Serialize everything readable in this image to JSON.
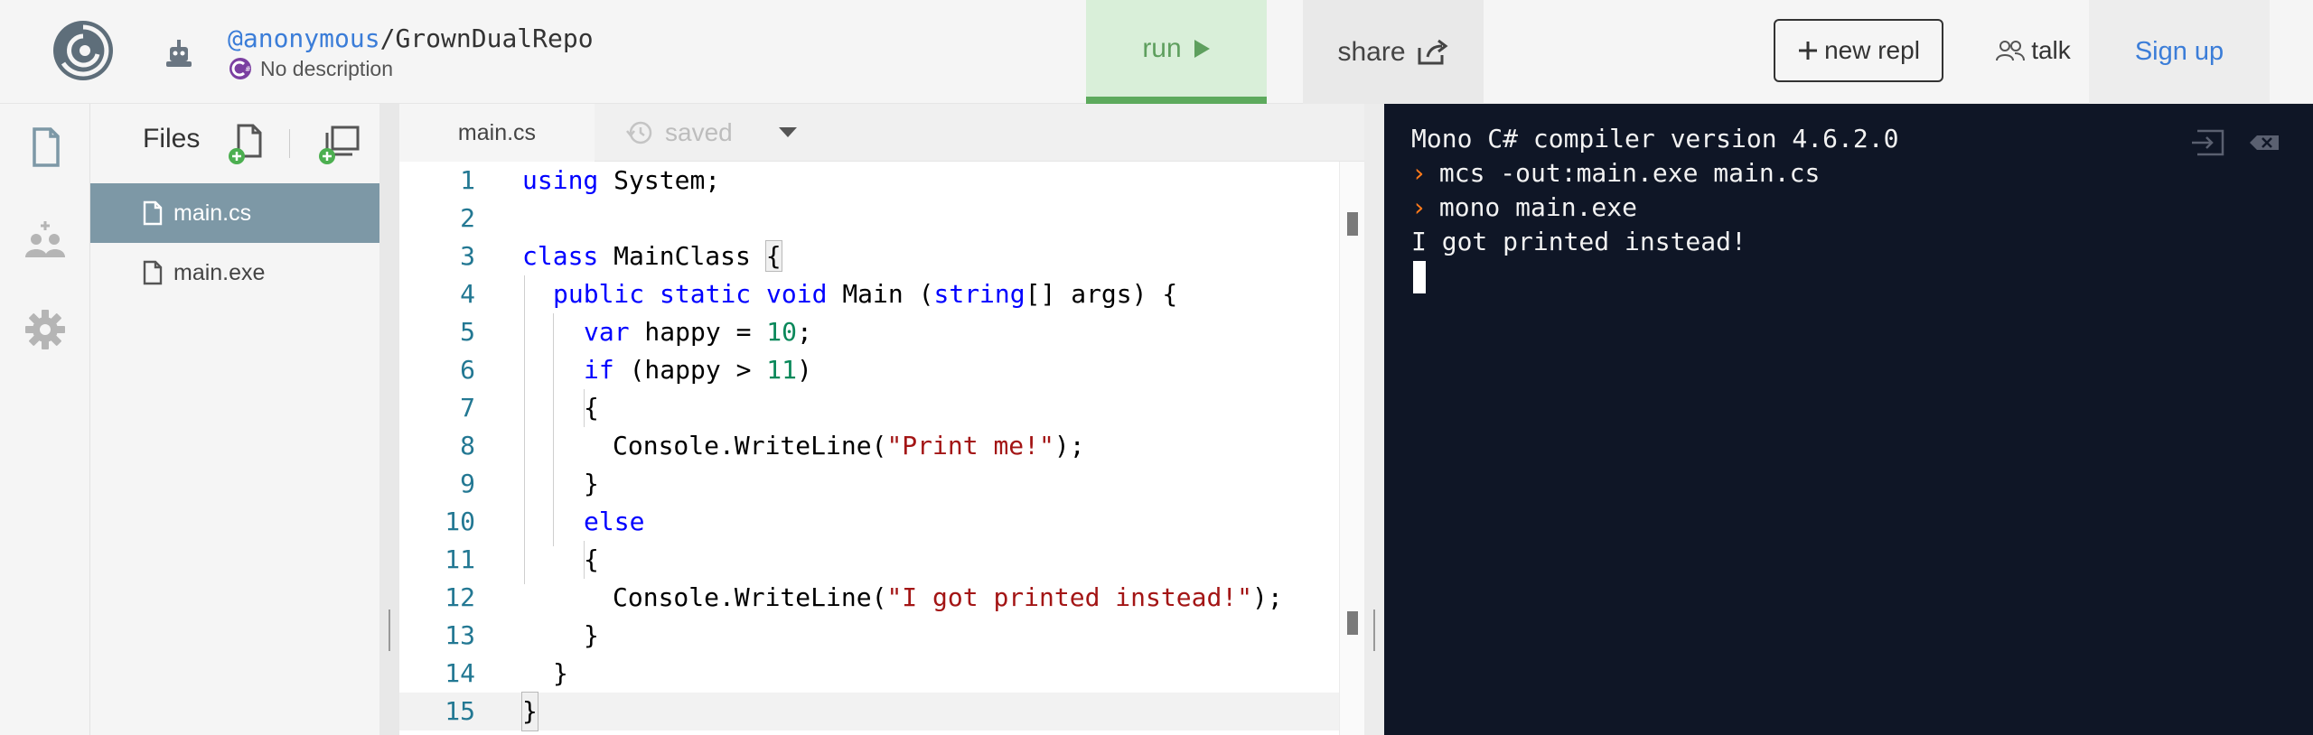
{
  "header": {
    "owner": "@anonymous",
    "separator": "/",
    "repo": "GrownDualRepo",
    "description": "No description",
    "run_label": "run",
    "share_label": "share",
    "new_repl_label": "new repl",
    "talk_label": "talk",
    "signup_label": "Sign up"
  },
  "files": {
    "heading": "Files",
    "items": [
      {
        "name": "main.cs",
        "active": true
      },
      {
        "name": "main.exe",
        "active": false
      }
    ]
  },
  "editor": {
    "tab_label": "main.cs",
    "saved_label": "saved",
    "lines": [
      {
        "n": "1"
      },
      {
        "n": "2"
      },
      {
        "n": "3"
      },
      {
        "n": "4"
      },
      {
        "n": "5"
      },
      {
        "n": "6"
      },
      {
        "n": "7"
      },
      {
        "n": "8"
      },
      {
        "n": "9"
      },
      {
        "n": "10"
      },
      {
        "n": "11"
      },
      {
        "n": "12"
      },
      {
        "n": "13"
      },
      {
        "n": "14"
      },
      {
        "n": "15"
      }
    ],
    "code": {
      "l1_kw": "using",
      "l1_rest": " System;",
      "l3_kw": "class",
      "l3_rest": " MainClass ",
      "l3_brace": "{",
      "l4_kw1": "public",
      "l4_kw2": "static",
      "l4_kw3": "void",
      "l4_mid": " Main (",
      "l4_kw4": "string",
      "l4_rest": "[] args) {",
      "l5_kw": "var",
      "l5_mid": " happy = ",
      "l5_num": "10",
      "l5_end": ";",
      "l6_kw": "if",
      "l6_mid": " (happy > ",
      "l6_num": "11",
      "l6_end": ")",
      "l7": "{",
      "l8_pre": "Console.WriteLine(",
      "l8_str": "\"Print me!\"",
      "l8_end": ");",
      "l9": "}",
      "l10_kw": "else",
      "l11": "{",
      "l12_pre": "Console.WriteLine(",
      "l12_str": "\"I got printed instead!\"",
      "l12_end": ");",
      "l13": "}",
      "l14": "}",
      "l15": "}"
    }
  },
  "console": {
    "lines": [
      {
        "prompt": false,
        "text": "Mono C# compiler version 4.6.2.0"
      },
      {
        "prompt": true,
        "text": "mcs -out:main.exe main.cs"
      },
      {
        "prompt": true,
        "text": "mono main.exe"
      },
      {
        "prompt": false,
        "text": "I got printed instead!"
      }
    ],
    "prompt_glyph": "›"
  },
  "colors": {
    "run_bg": "#d9efd9",
    "run_accent": "#5daa5d",
    "link_blue": "#3b7dd8",
    "console_bg": "#0f1626",
    "prompt_orange": "#ff7a1a",
    "active_file_bg": "#7d98a6"
  }
}
